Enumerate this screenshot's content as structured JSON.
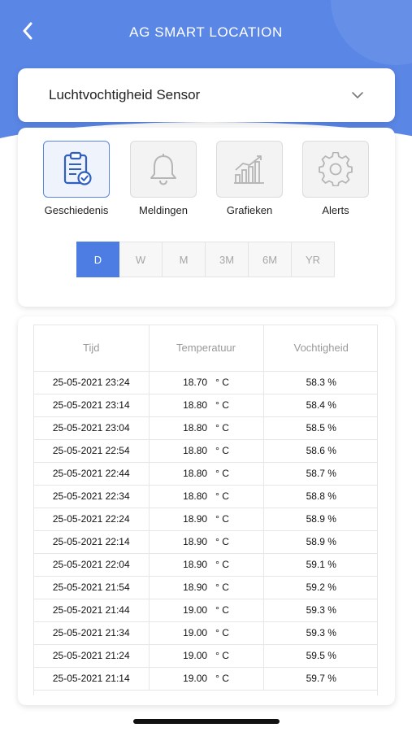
{
  "header": {
    "title": "AG SMART LOCATION",
    "background_color": "#5a86e6",
    "back_icon": "chevron-left-icon"
  },
  "sensor_select": {
    "value": "Luchtvochtigheid Sensor",
    "icon": "chevron-down-icon"
  },
  "menu": {
    "items": [
      {
        "label": "Geschiedenis",
        "icon": "clipboard-check-icon",
        "active": true
      },
      {
        "label": "Meldingen",
        "icon": "bell-icon",
        "active": false
      },
      {
        "label": "Grafieken",
        "icon": "bar-chart-icon",
        "active": false
      },
      {
        "label": "Alerts",
        "icon": "gear-icon",
        "active": false
      }
    ]
  },
  "periods": {
    "options": [
      "D",
      "W",
      "M",
      "3M",
      "6M",
      "YR"
    ],
    "selected": "D",
    "accent_color": "#4d7de2"
  },
  "table": {
    "headers": [
      "Tijd",
      "Temperatuur",
      "Vochtigheid"
    ],
    "rows": [
      [
        "25-05-2021 23:24",
        "18.70   ° C",
        "58.3 %"
      ],
      [
        "25-05-2021 23:14",
        "18.80   ° C",
        "58.4 %"
      ],
      [
        "25-05-2021 23:04",
        "18.80   ° C",
        "58.5 %"
      ],
      [
        "25-05-2021 22:54",
        "18.80   ° C",
        "58.6 %"
      ],
      [
        "25-05-2021 22:44",
        "18.80   ° C",
        "58.7 %"
      ],
      [
        "25-05-2021 22:34",
        "18.80   ° C",
        "58.8 %"
      ],
      [
        "25-05-2021 22:24",
        "18.90   ° C",
        "58.9 %"
      ],
      [
        "25-05-2021 22:14",
        "18.90   ° C",
        "58.9 %"
      ],
      [
        "25-05-2021 22:04",
        "18.90   ° C",
        "59.1 %"
      ],
      [
        "25-05-2021 21:54",
        "18.90   ° C",
        "59.2 %"
      ],
      [
        "25-05-2021 21:44",
        "19.00   ° C",
        "59.3 %"
      ],
      [
        "25-05-2021 21:34",
        "19.00   ° C",
        "59.3 %"
      ],
      [
        "25-05-2021 21:24",
        "19.00   ° C",
        "59.5 %"
      ],
      [
        "25-05-2021 21:14",
        "19.00   ° C",
        "59.7 %"
      ]
    ]
  }
}
